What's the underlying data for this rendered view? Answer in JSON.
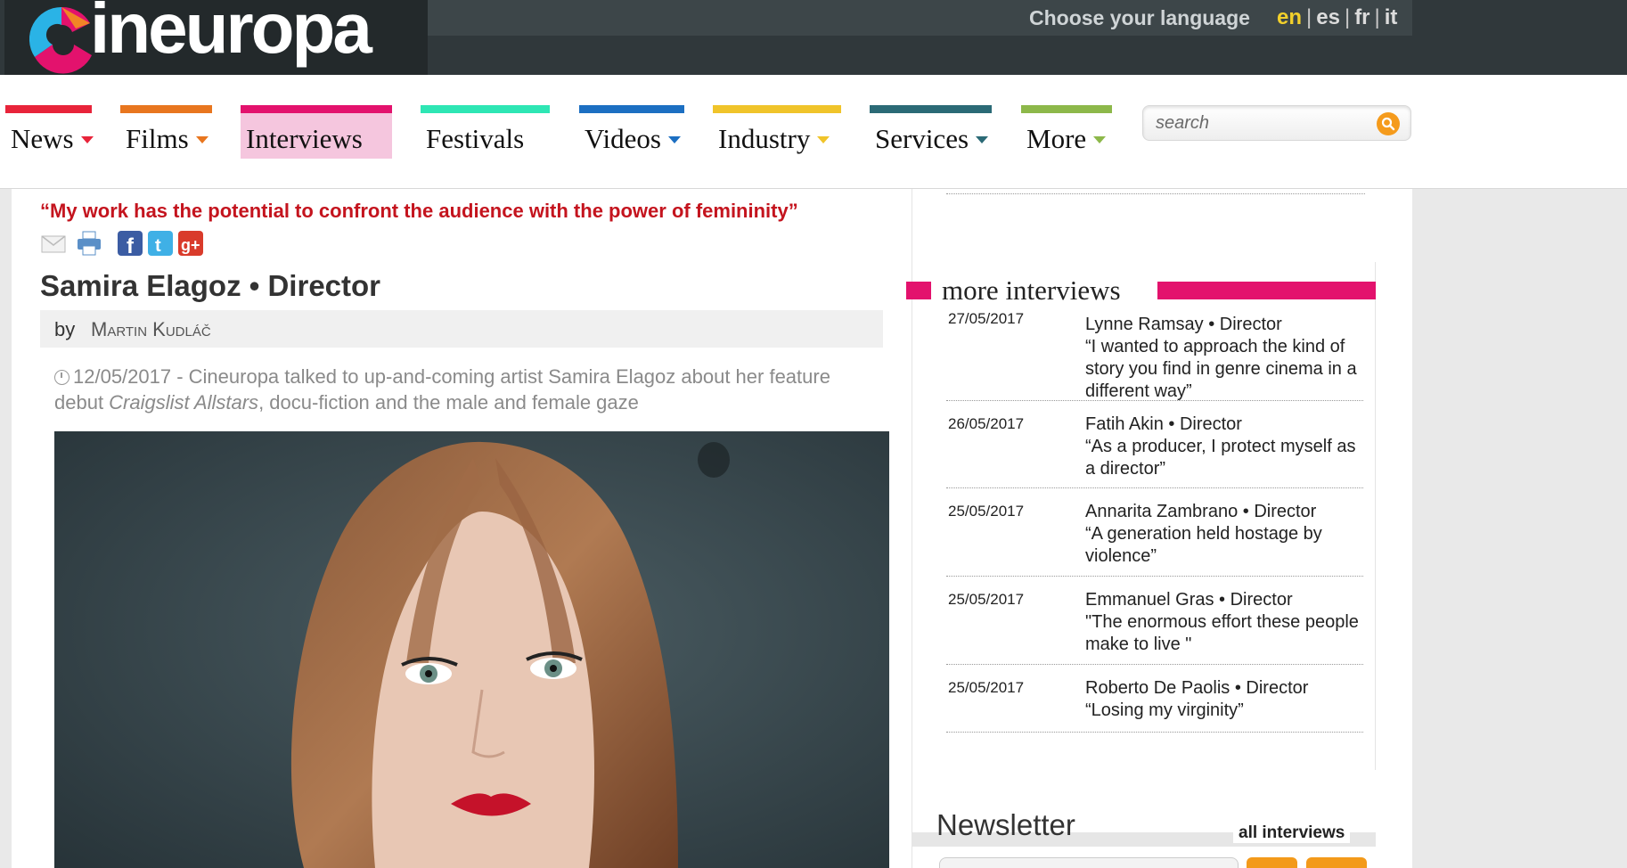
{
  "brand": {
    "logo_text": "ineuropa",
    "logo_colors": [
      "#2ab3e6",
      "#e3126d",
      "#f39a1a"
    ]
  },
  "language": {
    "label": "Choose your language",
    "options": [
      "en",
      "es",
      "fr",
      "it"
    ],
    "active": "en"
  },
  "nav": {
    "items": [
      {
        "label": "News",
        "color": "#e8243a",
        "dropdown": true
      },
      {
        "label": "Films",
        "color": "#e8761f",
        "dropdown": true
      },
      {
        "label": "Interviews",
        "color": "#e3126d",
        "dropdown": false,
        "active": true
      },
      {
        "label": "Festivals",
        "color": "#2ee6b4",
        "dropdown": false
      },
      {
        "label": "Videos",
        "color": "#1c6fc2",
        "dropdown": true
      },
      {
        "label": "Industry",
        "color": "#f0c42a",
        "dropdown": true
      },
      {
        "label": "Services",
        "color": "#2b6a76",
        "dropdown": true
      },
      {
        "label": "More",
        "color": "#8db84a",
        "dropdown": true
      }
    ],
    "search_placeholder": "search"
  },
  "article": {
    "tagline": "“My work has the potential to confront the audience with the power of femininity”",
    "title": "Samira Elagoz • Director",
    "by_label": "by",
    "author": "Martin Kudláč",
    "summary_prefix": "12/05/2017 - Cineuropa talked to up-and-coming artist Samira Elagoz about her feature debut ",
    "summary_film": "Craigslist Allstars",
    "summary_suffix": ", docu-fiction and the male and female gaze",
    "share_icons": [
      "email-icon",
      "print-icon",
      "facebook-icon",
      "twitter-icon",
      "google-plus-icon"
    ]
  },
  "sidebar": {
    "heading": "more interviews",
    "interviews": [
      {
        "date": "27/05/2017",
        "name": "Lynne Ramsay • Director",
        "quote": "“I wanted to approach the kind of story you find in genre cinema in a different way”"
      },
      {
        "date": "26/05/2017",
        "name": "Fatih Akin • Director",
        "quote": "“As a producer, I protect myself as a director”"
      },
      {
        "date": "25/05/2017",
        "name": "Annarita Zambrano • Director",
        "quote": "“A generation held hostage by violence”"
      },
      {
        "date": "25/05/2017",
        "name": "Emmanuel Gras • Director",
        "quote": "\"The enormous effort these people make to live \""
      },
      {
        "date": "25/05/2017",
        "name": "Roberto De Paolis • Director",
        "quote": "“Losing my virginity”"
      }
    ],
    "all_link": "all interviews",
    "newsletter": "Newsletter"
  }
}
